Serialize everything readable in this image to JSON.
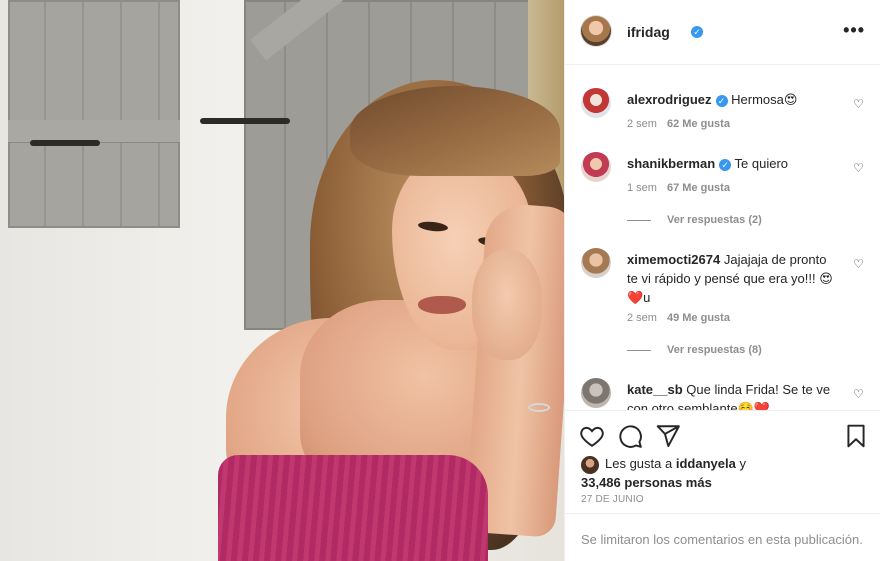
{
  "post": {
    "author": "ifridag",
    "more_label": "•••"
  },
  "comments": [
    {
      "user": "alexrodriguez",
      "text": "Hermosa😍",
      "time": "2 sem",
      "likes": "62 Me gusta",
      "verified": true,
      "replies": ""
    },
    {
      "user": "shanikberman",
      "text": "Te quiero",
      "time": "1 sem",
      "likes": "67 Me gusta",
      "verified": true,
      "replies": "Ver respuestas (2)"
    },
    {
      "user": "ximemocti2674",
      "text": "Jajajaja de pronto te vi rápido y pensé que era yo!!! 😍 ❤️u",
      "time": "2 sem",
      "likes": "49 Me gusta",
      "verified": false,
      "replies": "Ver respuestas (8)"
    },
    {
      "user": "kate__sb",
      "text": "Que linda Frida! Se te ve con otro semblante☺️❤️",
      "time": "",
      "likes": "",
      "verified": false,
      "replies": ""
    }
  ],
  "likes": {
    "prefix": "Les gusta a",
    "user": "iddanyela",
    "suffix": "y",
    "count": "33,486 personas más"
  },
  "date": "27 DE JUNIO",
  "comments_limited": "Se limitaron los comentarios en esta publicación.",
  "colors": {
    "verified": "#3897f0",
    "muted": "#8e8e8e",
    "text": "#262626"
  }
}
